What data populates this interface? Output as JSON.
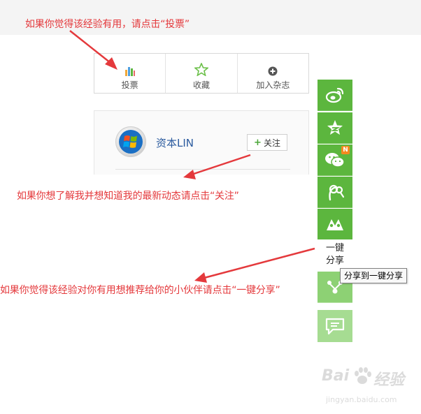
{
  "annotations": {
    "vote_hint": "如果你觉得该经验有用，请点击“投票”",
    "follow_hint": "如果你想了解我并想知道我的最新动态请点击“关注”",
    "share_hint": "如果你觉得该经验对你有用想推荐给你的小伙伴请点击“一键分享”",
    "color": "#e4393c"
  },
  "actions": {
    "vote_label": "投票",
    "favorite_label": "收藏",
    "magazine_label": "加入杂志"
  },
  "profile": {
    "username": "资本LIN",
    "follow_label": "关注"
  },
  "share": {
    "one_key_label_line1": "一键",
    "one_key_label_line2": "分享",
    "tooltip": "分享到一键分享",
    "new_badge": "N",
    "icons": [
      "weibo-icon",
      "qzone-icon",
      "wechat-icon",
      "renren-icon",
      "kaixin-icon",
      "share-arrow-icon",
      "comment-icon"
    ],
    "accent_color": "#5cb63e"
  },
  "watermark": {
    "brand": "Bai",
    "brand_cn": "经验",
    "url": "jingyan.baidu.com"
  }
}
